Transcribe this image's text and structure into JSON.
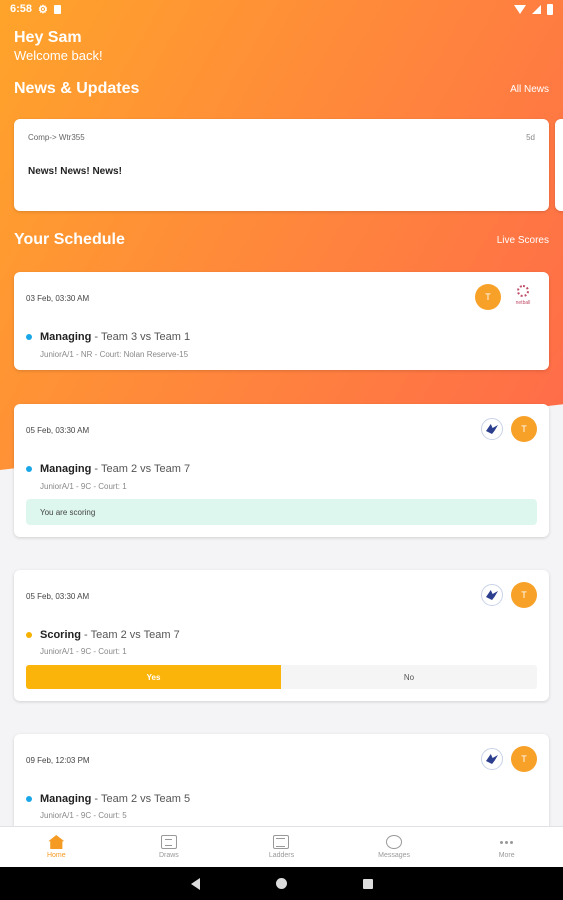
{
  "status_bar": {
    "time": "6:58"
  },
  "header": {
    "greeting": "Hey Sam",
    "subtitle": "Welcome back!"
  },
  "news": {
    "title": "News & Updates",
    "link": "All News",
    "item": {
      "source": "Comp-> Wtr355",
      "age": "5d",
      "title": "News! News! News!"
    }
  },
  "schedule": {
    "title": "Your Schedule",
    "link": "Live Scores",
    "matches": [
      {
        "date": "03 Feb, 03:30 AM",
        "role": "Managing",
        "vs": "Team 3 vs Team 1",
        "meta": "JuniorA/1 - NR - Court: Nolan Reserve-15",
        "avatar": "T",
        "status_color": "blue",
        "logo_text": "netball"
      },
      {
        "date": "05 Feb, 03:30 AM",
        "role": "Managing",
        "vs": "Team 2 vs Team 7",
        "meta": "JuniorA/1 - 9C - Court: 1",
        "avatar": "T",
        "status_color": "blue",
        "note": "You are scoring"
      },
      {
        "date": "05 Feb, 03:30 AM",
        "role": "Scoring",
        "vs": "Team 2 vs Team 7",
        "meta": "JuniorA/1 - 9C - Court: 1",
        "avatar": "T",
        "status_color": "amber",
        "yes": "Yes",
        "no": "No"
      },
      {
        "date": "09 Feb, 12:03 PM",
        "role": "Managing",
        "vs": "Team 2 vs Team 5",
        "meta": "JuniorA/1 - 9C - Court: 5",
        "avatar": "T",
        "status_color": "blue"
      }
    ]
  },
  "bottom_nav": {
    "items": [
      {
        "label": "Home",
        "icon": "home-icon",
        "active": true
      },
      {
        "label": "Draws",
        "icon": "draws-icon"
      },
      {
        "label": "Ladders",
        "icon": "ladders-icon"
      },
      {
        "label": "Messages",
        "icon": "messages-icon"
      },
      {
        "label": "More",
        "icon": "more-icon"
      }
    ]
  },
  "colors": {
    "accent": "#f59a23",
    "gradient_start": "#ffa42a",
    "gradient_end": "#ff6a4a",
    "scoring_bg": "#ddf7ee",
    "yes_bg": "#fbb40a"
  }
}
